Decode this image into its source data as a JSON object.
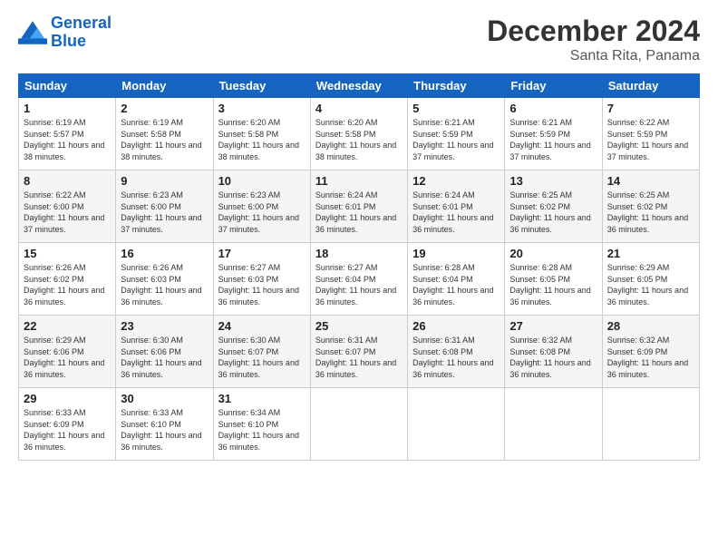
{
  "logo": {
    "line1": "General",
    "line2": "Blue"
  },
  "title": "December 2024",
  "location": "Santa Rita, Panama",
  "days_of_week": [
    "Sunday",
    "Monday",
    "Tuesday",
    "Wednesday",
    "Thursday",
    "Friday",
    "Saturday"
  ],
  "weeks": [
    [
      {
        "day": "1",
        "sunrise": "6:19 AM",
        "sunset": "5:57 PM",
        "daylight": "11 hours and 38 minutes."
      },
      {
        "day": "2",
        "sunrise": "6:19 AM",
        "sunset": "5:58 PM",
        "daylight": "11 hours and 38 minutes."
      },
      {
        "day": "3",
        "sunrise": "6:20 AM",
        "sunset": "5:58 PM",
        "daylight": "11 hours and 38 minutes."
      },
      {
        "day": "4",
        "sunrise": "6:20 AM",
        "sunset": "5:58 PM",
        "daylight": "11 hours and 38 minutes."
      },
      {
        "day": "5",
        "sunrise": "6:21 AM",
        "sunset": "5:59 PM",
        "daylight": "11 hours and 37 minutes."
      },
      {
        "day": "6",
        "sunrise": "6:21 AM",
        "sunset": "5:59 PM",
        "daylight": "11 hours and 37 minutes."
      },
      {
        "day": "7",
        "sunrise": "6:22 AM",
        "sunset": "5:59 PM",
        "daylight": "11 hours and 37 minutes."
      }
    ],
    [
      {
        "day": "8",
        "sunrise": "6:22 AM",
        "sunset": "6:00 PM",
        "daylight": "11 hours and 37 minutes."
      },
      {
        "day": "9",
        "sunrise": "6:23 AM",
        "sunset": "6:00 PM",
        "daylight": "11 hours and 37 minutes."
      },
      {
        "day": "10",
        "sunrise": "6:23 AM",
        "sunset": "6:00 PM",
        "daylight": "11 hours and 37 minutes."
      },
      {
        "day": "11",
        "sunrise": "6:24 AM",
        "sunset": "6:01 PM",
        "daylight": "11 hours and 36 minutes."
      },
      {
        "day": "12",
        "sunrise": "6:24 AM",
        "sunset": "6:01 PM",
        "daylight": "11 hours and 36 minutes."
      },
      {
        "day": "13",
        "sunrise": "6:25 AM",
        "sunset": "6:02 PM",
        "daylight": "11 hours and 36 minutes."
      },
      {
        "day": "14",
        "sunrise": "6:25 AM",
        "sunset": "6:02 PM",
        "daylight": "11 hours and 36 minutes."
      }
    ],
    [
      {
        "day": "15",
        "sunrise": "6:26 AM",
        "sunset": "6:02 PM",
        "daylight": "11 hours and 36 minutes."
      },
      {
        "day": "16",
        "sunrise": "6:26 AM",
        "sunset": "6:03 PM",
        "daylight": "11 hours and 36 minutes."
      },
      {
        "day": "17",
        "sunrise": "6:27 AM",
        "sunset": "6:03 PM",
        "daylight": "11 hours and 36 minutes."
      },
      {
        "day": "18",
        "sunrise": "6:27 AM",
        "sunset": "6:04 PM",
        "daylight": "11 hours and 36 minutes."
      },
      {
        "day": "19",
        "sunrise": "6:28 AM",
        "sunset": "6:04 PM",
        "daylight": "11 hours and 36 minutes."
      },
      {
        "day": "20",
        "sunrise": "6:28 AM",
        "sunset": "6:05 PM",
        "daylight": "11 hours and 36 minutes."
      },
      {
        "day": "21",
        "sunrise": "6:29 AM",
        "sunset": "6:05 PM",
        "daylight": "11 hours and 36 minutes."
      }
    ],
    [
      {
        "day": "22",
        "sunrise": "6:29 AM",
        "sunset": "6:06 PM",
        "daylight": "11 hours and 36 minutes."
      },
      {
        "day": "23",
        "sunrise": "6:30 AM",
        "sunset": "6:06 PM",
        "daylight": "11 hours and 36 minutes."
      },
      {
        "day": "24",
        "sunrise": "6:30 AM",
        "sunset": "6:07 PM",
        "daylight": "11 hours and 36 minutes."
      },
      {
        "day": "25",
        "sunrise": "6:31 AM",
        "sunset": "6:07 PM",
        "daylight": "11 hours and 36 minutes."
      },
      {
        "day": "26",
        "sunrise": "6:31 AM",
        "sunset": "6:08 PM",
        "daylight": "11 hours and 36 minutes."
      },
      {
        "day": "27",
        "sunrise": "6:32 AM",
        "sunset": "6:08 PM",
        "daylight": "11 hours and 36 minutes."
      },
      {
        "day": "28",
        "sunrise": "6:32 AM",
        "sunset": "6:09 PM",
        "daylight": "11 hours and 36 minutes."
      }
    ],
    [
      {
        "day": "29",
        "sunrise": "6:33 AM",
        "sunset": "6:09 PM",
        "daylight": "11 hours and 36 minutes."
      },
      {
        "day": "30",
        "sunrise": "6:33 AM",
        "sunset": "6:10 PM",
        "daylight": "11 hours and 36 minutes."
      },
      {
        "day": "31",
        "sunrise": "6:34 AM",
        "sunset": "6:10 PM",
        "daylight": "11 hours and 36 minutes."
      },
      null,
      null,
      null,
      null
    ]
  ]
}
